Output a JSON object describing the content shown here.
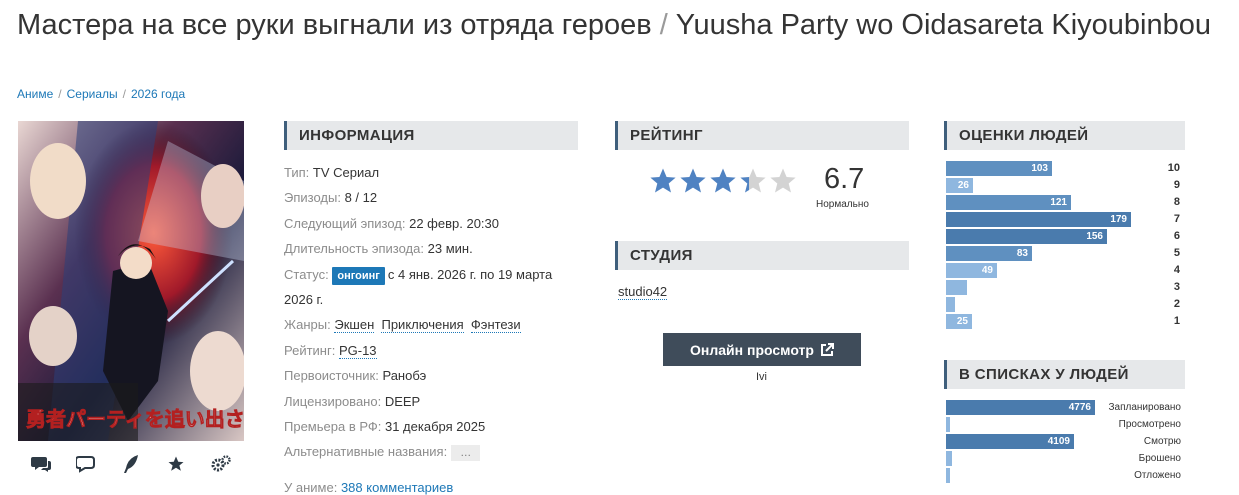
{
  "header": {
    "title_ru": "Мастера на все руки выгнали из отряда героев",
    "title_sep": "/",
    "title_en": "Yuusha Party wo Oidasareta Kiyoubinbou"
  },
  "breadcrumbs": [
    "Аниме",
    "Сериалы",
    "2026 года"
  ],
  "poster": {
    "alt": "Yuusha Party wo Oidasareta Kiyoubinbou poster",
    "text": "勇者パーティを追い出された器用貧乏"
  },
  "poster_actions": [
    {
      "icon": "comments-icon"
    },
    {
      "icon": "reviews-icon"
    },
    {
      "icon": "quill-icon"
    },
    {
      "icon": "star-icon"
    },
    {
      "icon": "gears-icon"
    }
  ],
  "info": {
    "heading": "Информация",
    "type_key": "Тип:",
    "type_val": "TV Сериал",
    "episodes_key": "Эпизоды:",
    "episodes_val": "8 / 12",
    "next_key": "Следующий эпизод:",
    "next_val": "22 февр. 20:30",
    "duration_key": "Длительность эпизода:",
    "duration_val": "23 мин.",
    "status_key": "Статус:",
    "status_badge": "онгоинг",
    "status_val": "с 4 янв. 2026 г. по 19 марта 2026 г.",
    "genres_key": "Жанры:",
    "genres": [
      "Экшен",
      "Приключения",
      "Фэнтези"
    ],
    "rating_key": "Рейтинг:",
    "rating_val": "PG-13",
    "source_key": "Первоисточник:",
    "source_val": "Ранобэ",
    "licensed_key": "Лицензировано:",
    "licensed_val": "DEEP",
    "premiere_key": "Премьера в РФ:",
    "premiere_val": "31 декабря 2025",
    "alt_names_key": "Альтернативные названия:",
    "alt_names_btn": "…",
    "comments_key": "У аниме:",
    "comments_val": "388 комментариев"
  },
  "rating": {
    "heading": "Рейтинг",
    "score": "6.7",
    "stars_filled": 3.35,
    "note": "Нормально",
    "star_color": "#4f82c2",
    "star_empty_color": "#d3d3d3"
  },
  "studio": {
    "heading": "Студия",
    "name": "studio42"
  },
  "watch": {
    "label": "Онлайн просмотр",
    "sub": "Ivi"
  },
  "people_scores": {
    "heading": "Оценки людей",
    "max": 179,
    "rows": [
      {
        "score": "10",
        "count": 103
      },
      {
        "score": "9",
        "count": 26
      },
      {
        "score": "8",
        "count": 121
      },
      {
        "score": "7",
        "count": 179
      },
      {
        "score": "6",
        "count": 156
      },
      {
        "score": "5",
        "count": 83
      },
      {
        "score": "4",
        "count": 49
      },
      {
        "score": "3",
        "count": 20
      },
      {
        "score": "2",
        "count": 9
      },
      {
        "score": "1",
        "count": 25
      }
    ]
  },
  "people_lists": {
    "heading": "В списках у людей",
    "max": 4776,
    "rows": [
      {
        "label": "Запланировано",
        "count": 4776
      },
      {
        "label": "Просмотрено",
        "count": 140
      },
      {
        "label": "Смотрю",
        "count": 4109
      },
      {
        "label": "Брошено",
        "count": 200
      },
      {
        "label": "Отложено",
        "count": 140
      }
    ]
  },
  "colors": {
    "accent": "#1d78b7",
    "bar_dark": "#4a7bad",
    "bar_mid": "#5f90c0",
    "bar_light": "#8fb7df",
    "head_bg": "#e6e8ea"
  }
}
